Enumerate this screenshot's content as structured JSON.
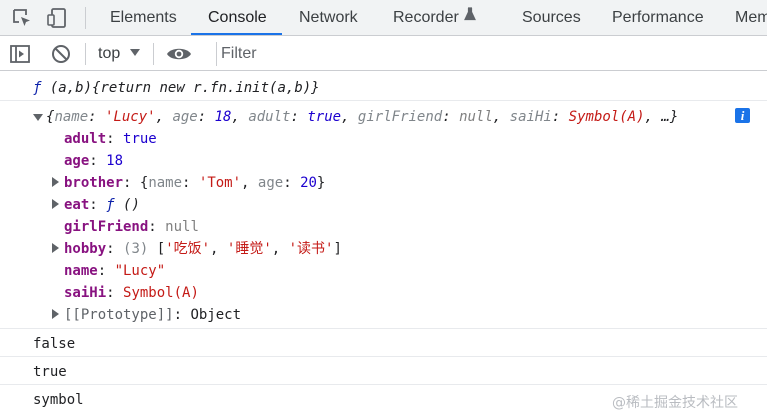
{
  "tabs": [
    {
      "label": "Elements"
    },
    {
      "label": "Console"
    },
    {
      "label": "Network"
    },
    {
      "label": "Recorder"
    },
    {
      "label": "Sources"
    },
    {
      "label": "Performance"
    },
    {
      "label": "Mem"
    }
  ],
  "toolbar": {
    "context": "top",
    "filter_placeholder": "Filter"
  },
  "console": {
    "line1": {
      "f": "ƒ",
      "params": "(a,b)",
      "body": "{return new r.fn.init(a,b)}"
    },
    "summary": {
      "open": "{",
      "name_key": "name",
      "name_val": "'Lucy'",
      "age_key": "age",
      "age_val": "18",
      "adult_key": "adult",
      "adult_val": "true",
      "gf_key": "girlFriend",
      "gf_val": "null",
      "sai_key": "saiHi",
      "sai_val": "Symbol(A)",
      "ellipsis": "…}",
      "info": "i"
    },
    "props": {
      "adult": {
        "key": "adult",
        "value": "true"
      },
      "age": {
        "key": "age",
        "value": "18"
      },
      "brother": {
        "key": "brother",
        "open": "{",
        "name_key": "name",
        "name_val": "'Tom'",
        "age_key": "age",
        "age_val": "20",
        "close": "}"
      },
      "eat": {
        "key": "eat",
        "f": "ƒ",
        "value": "()"
      },
      "girlFriend": {
        "key": "girlFriend",
        "value": "null"
      },
      "hobby": {
        "key": "hobby",
        "count": "(3)",
        "open": "[",
        "v1": "'吃饭'",
        "v2": "'睡觉'",
        "v3": "'读书'",
        "close": "]"
      },
      "name": {
        "key": "name",
        "value": "\"Lucy\""
      },
      "saiHi": {
        "key": "saiHi",
        "value": "Symbol(A)"
      },
      "prototype": {
        "key": "[[Prototype]]",
        "value": "Object"
      }
    },
    "log_false": "false",
    "log_true": "true",
    "log_symbol": "symbol"
  },
  "watermark": "@稀土掘金技术社区",
  "colors": {
    "accent": "#1a73e8",
    "key": "#881280",
    "string": "#c41a16",
    "number": "#1c00cf"
  }
}
